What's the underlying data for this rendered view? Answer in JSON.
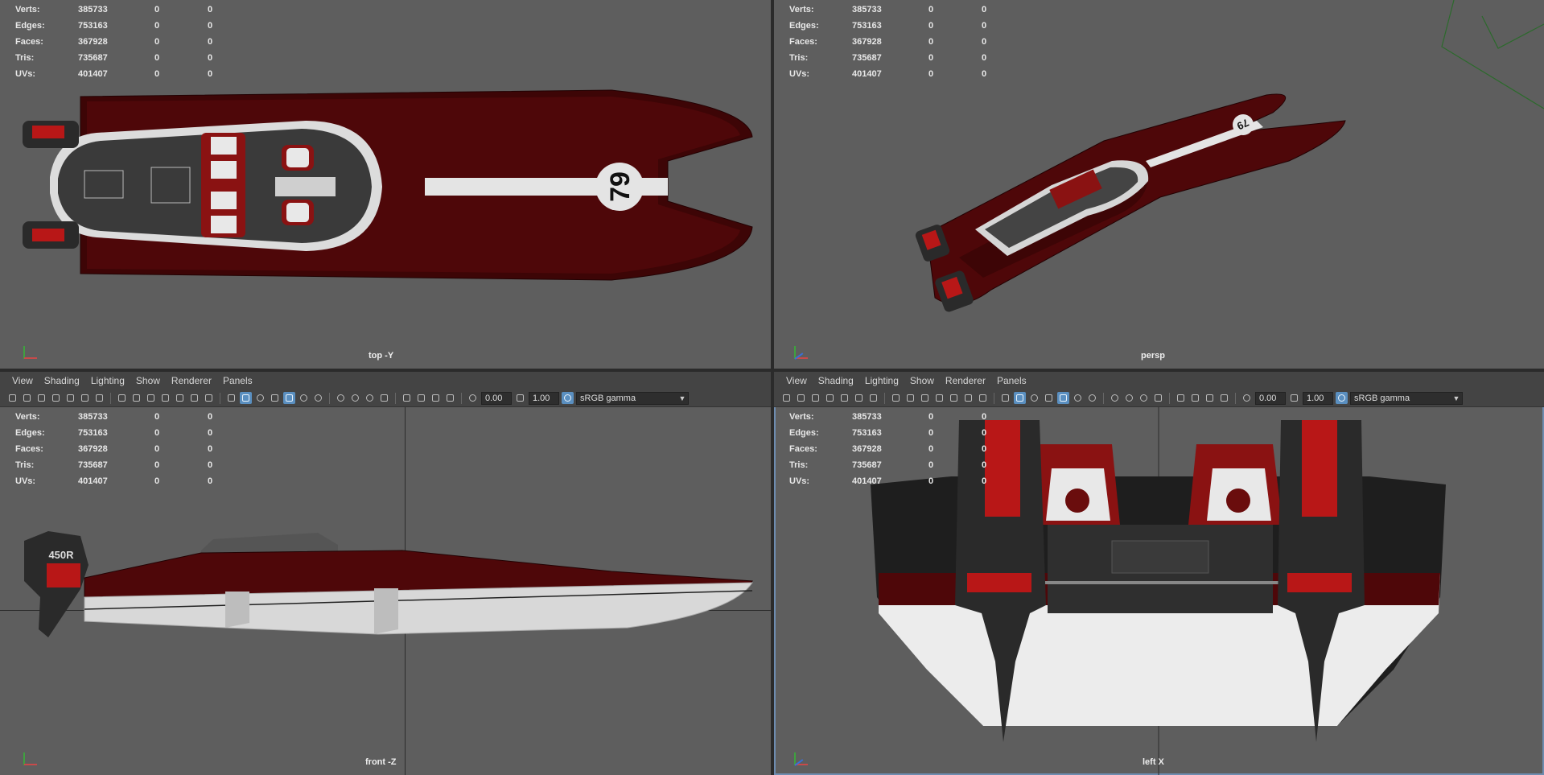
{
  "stats": {
    "labels": [
      "Verts:",
      "Edges:",
      "Faces:",
      "Tris:",
      "UVs:"
    ],
    "values": [
      "385733",
      "753163",
      "367928",
      "735687",
      "401407"
    ],
    "zeros_a": [
      "0",
      "0",
      "0",
      "0",
      "0"
    ],
    "zeros_b": [
      "0",
      "0",
      "0",
      "0",
      "0"
    ]
  },
  "menu": {
    "view": "View",
    "shading": "Shading",
    "lighting": "Lighting",
    "show": "Show",
    "renderer": "Renderer",
    "panels": "Panels"
  },
  "toolbar": {
    "exposure": "0.00",
    "gamma": "1.00",
    "color_space": "sRGB gamma"
  },
  "viewports": {
    "top": "top -Y",
    "persp": "persp",
    "front": "front -Z",
    "left": "left X"
  },
  "boat": {
    "race_number": "79",
    "engine_label": "450R",
    "colors": {
      "hull_dark": "#3d0506",
      "hull": "#5a0a0c",
      "stripe": "#e4e4e4",
      "engine_red": "#b81717",
      "engine_dark": "#2a2a2a",
      "deck": "#3a3a3a",
      "viewport_bg": "#5e5e5e"
    }
  }
}
